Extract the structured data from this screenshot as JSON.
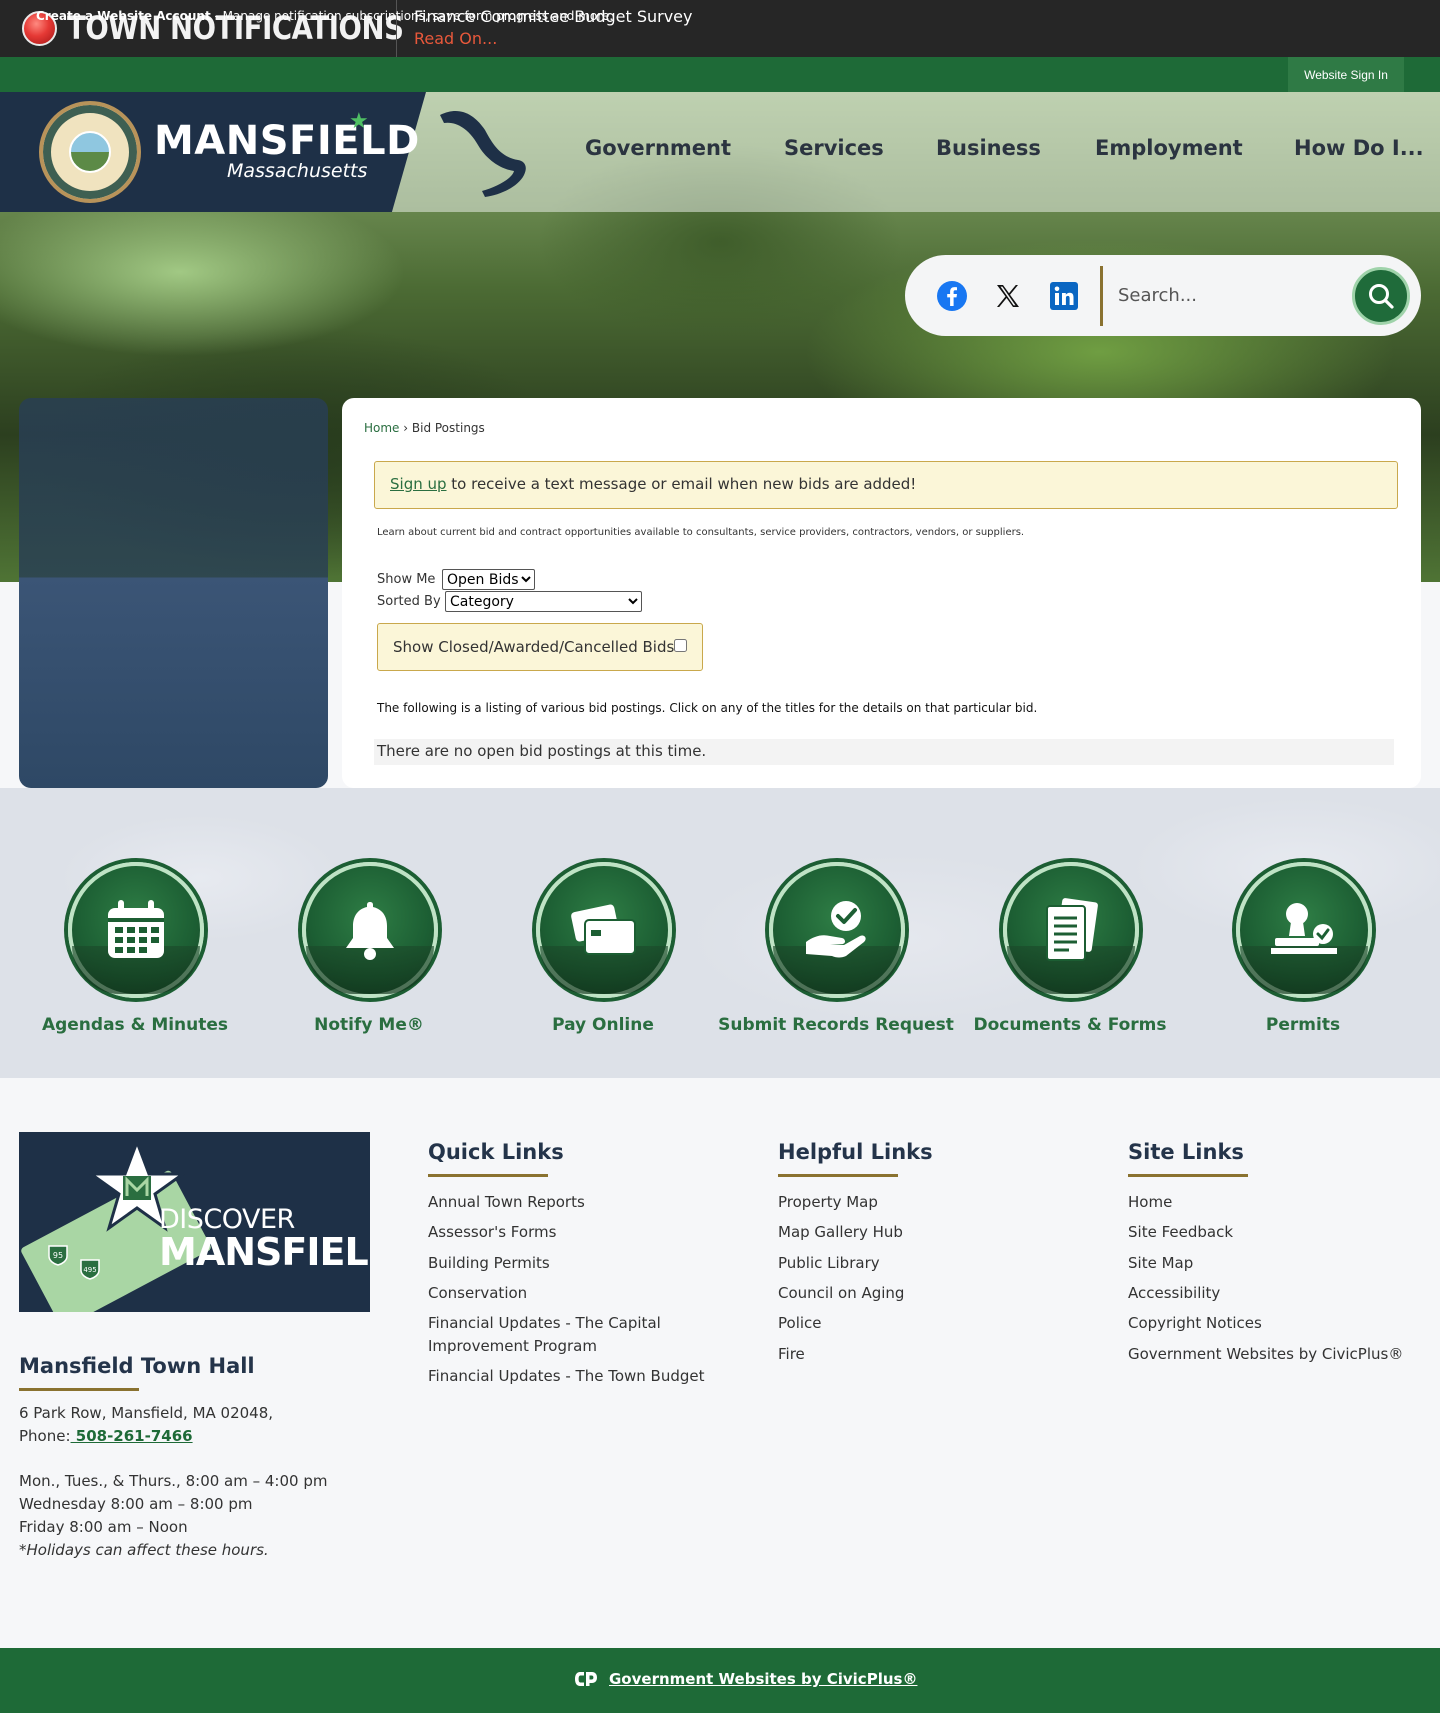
{
  "alert": {
    "title": "TOWN NOTIFICATIONS",
    "message": "Finance Committee Budget Survey",
    "link": "Read On..."
  },
  "account_bar": {
    "create_account": "Create a Website Account",
    "description": " - Manage notification subscriptions, save form progress and more.",
    "sign_in": "Website Sign In"
  },
  "header": {
    "brand_name": "MANSFIELD",
    "brand_state": "Massachusetts",
    "nav": [
      "Government",
      "Services",
      "Business",
      "Employment",
      "How Do I..."
    ]
  },
  "search": {
    "placeholder": "Search..."
  },
  "social": [
    "facebook-icon",
    "x-icon",
    "linkedin-icon"
  ],
  "breadcrumb": {
    "home": "Home",
    "separator": " › ",
    "current": "Bid Postings"
  },
  "notice": {
    "link": "Sign up",
    "text": " to receive a text message or email when new bids are added!"
  },
  "intro": "Learn about current bid and contract opportunities available to consultants, service providers, contractors, vendors, or suppliers.",
  "filters": {
    "show_me_label": "Show Me",
    "show_me_value": "Open Bids",
    "sorted_by_label": "Sorted By",
    "sorted_by_value": "Category",
    "closed_label": "Show Closed/Awarded/Cancelled Bids:"
  },
  "listing_text": "The following is a listing of various bid postings. Click on any of the titles for the details on that particular bid.",
  "empty_text": "There are no open bid postings at this time.",
  "quick_icons": [
    {
      "label": "Agendas & Minutes",
      "icon": "calendar-icon"
    },
    {
      "label": "Notify Me®",
      "icon": "bell-icon"
    },
    {
      "label": "Pay Online",
      "icon": "credit-card-icon"
    },
    {
      "label": "Submit Records Request",
      "icon": "hand-check-icon"
    },
    {
      "label": "Documents & Forms",
      "icon": "document-icon"
    },
    {
      "label": "Permits",
      "icon": "stamp-icon"
    }
  ],
  "discover": {
    "line1": "DISCOVER",
    "line2": "MANSFIELD",
    "route1": "95",
    "route2": "495"
  },
  "town_hall": {
    "title": "Mansfield Town Hall",
    "address": "6 Park Row, Mansfield, MA 02048,",
    "phone_label": "Phone:",
    "phone": " 508-261-7466",
    "hours1": "Mon., Tues., & Thurs., 8:00 am – 4:00 pm",
    "hours2": "Wednesday 8:00 am – 8:00 pm",
    "hours3": "Friday 8:00 am – Noon",
    "note": "*Holidays can affect these hours."
  },
  "quick_links": {
    "title": "Quick Links",
    "items": [
      "Annual Town Reports",
      "Assessor's Forms",
      "Building Permits",
      "Conservation",
      "Financial Updates - The Capital",
      "Improvement Program",
      "Financial Updates - The Town Budget"
    ]
  },
  "helpful_links": {
    "title": "Helpful Links",
    "items": [
      "Property Map",
      "Map Gallery Hub",
      "Public Library",
      "Council on Aging",
      "Police",
      "Fire"
    ]
  },
  "site_links": {
    "title": "Site Links",
    "items": [
      "Home",
      "Site Feedback",
      "Site Map",
      "Accessibility",
      "Copyright Notices",
      "Government Websites by CivicPlus®"
    ]
  },
  "bottom_bar": {
    "text": "Government Websites by CivicPlus®"
  },
  "colors": {
    "green_dark": "#1e6a37",
    "navy": "#1e3047",
    "gold": "#8a7230",
    "alert_red": "#e8583b"
  }
}
